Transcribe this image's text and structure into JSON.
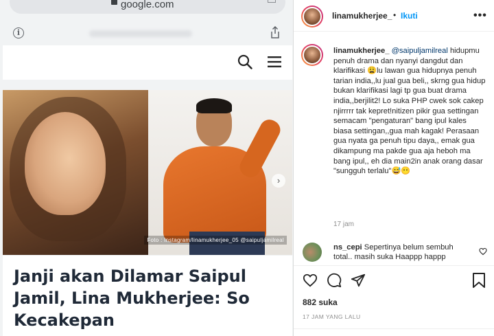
{
  "browser": {
    "url": "google.com"
  },
  "article": {
    "photo_caption": "Foto : Instagram/linamukherjee_05 @saipuljamilreal",
    "headline": "Janji akan Dilamar Saipul Jamil, Lina Mukherjee: So Kecakepan"
  },
  "instagram": {
    "header": {
      "username": "linamukherjee_",
      "separator": "•",
      "follow_label": "Ikuti",
      "more_label": "•••"
    },
    "caption": {
      "username": "linamukherjee_",
      "mention": "@saipuljamilreal",
      "text": "hidupmu penuh drama dan nyanyi dangdut dan klarifikasi 😩lu lawan gua hidupnya penuh tarian india,,lu jual gua beli,, skrng gua hidup bukan klarifikasi lagi tp gua buat drama india,,berjilit2! Lo suka PHP cwek sok cakep njirrrrr tak kepret!nitizen pikir gua settingan semacam \"pengaturan\" bang ipul kales biasa settingan,,gua mah kagak! Perasaan gua nyata ga penuh tipu daya,, emak gua dikampung ma pakde gua aja heboh ma bang ipul,, eh dia main2in anak orang dasar \"sungguh terlalu\"😅😶",
      "time": "17 jam"
    },
    "comment": {
      "username": "ns_cepi",
      "text": "Sepertinya belum sembuh total.. masih suka Haappp happp"
    },
    "likes": "882 suka",
    "date": "17 JAM YANG LALU"
  },
  "icons": {
    "info": "info-icon",
    "search": "search-icon",
    "menu": "menu-icon",
    "like": "heart-icon",
    "comment": "comment-icon",
    "share": "share-icon",
    "save": "bookmark-icon"
  },
  "colors": {
    "follow": "#0095f6",
    "mention": "#00376b",
    "muted": "#8e8e8e"
  }
}
